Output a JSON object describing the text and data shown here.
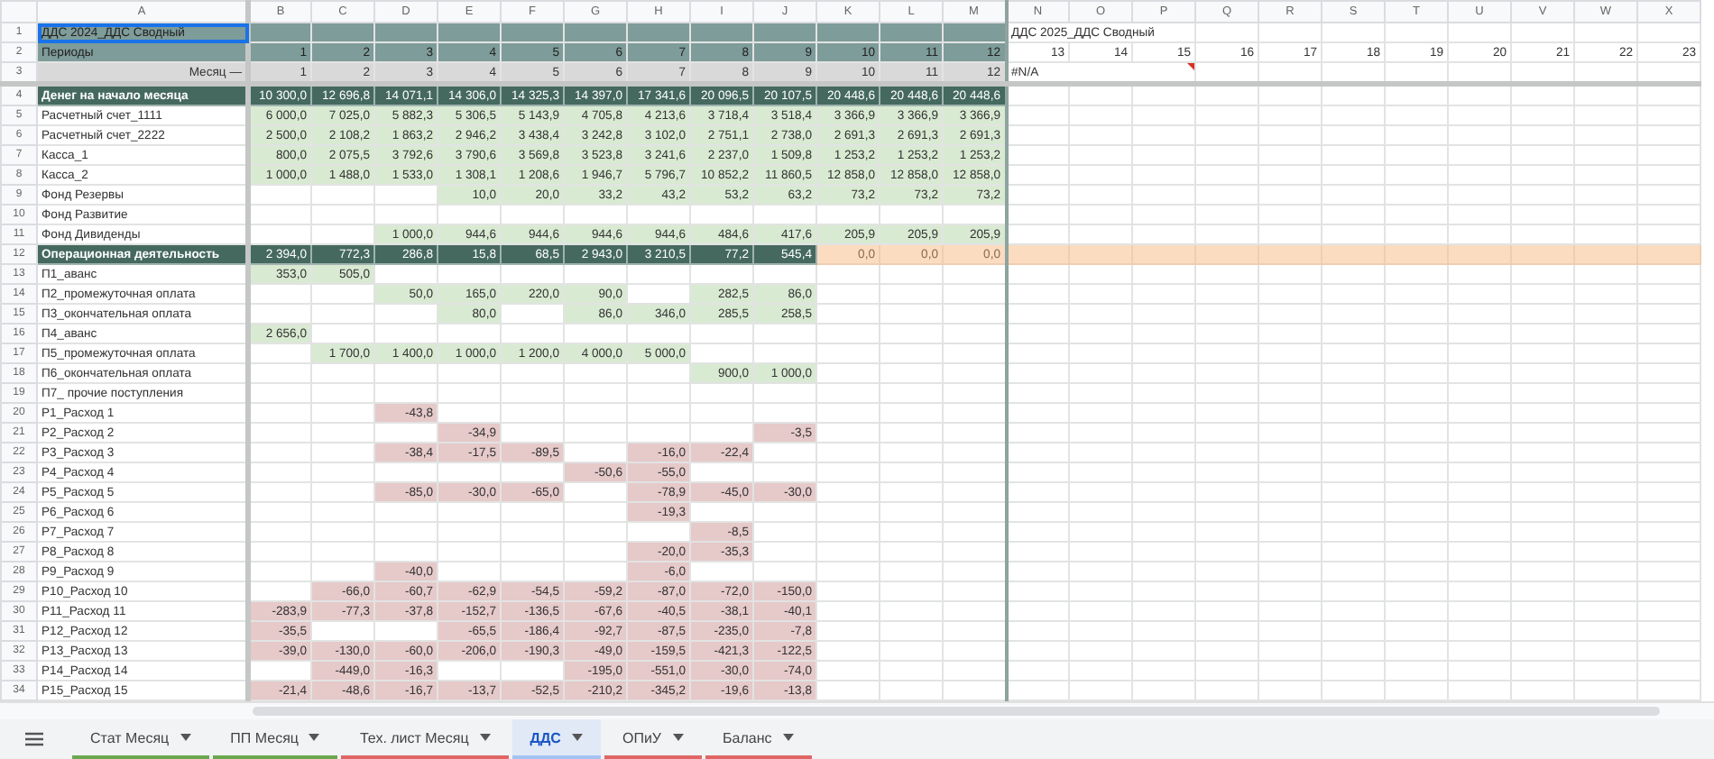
{
  "sheet": {
    "column_headers": [
      "A",
      "B",
      "C",
      "D",
      "E",
      "F",
      "G",
      "H",
      "I",
      "J",
      "K",
      "L",
      "M",
      "N",
      "O",
      "P",
      "Q",
      "R",
      "S",
      "T",
      "U",
      "V",
      "W",
      "X"
    ],
    "rows": [
      {
        "number": "1",
        "kind": "title",
        "label": "ДДС 2024_ДДС Сводный",
        "selected": true,
        "cells": [
          null,
          null,
          null,
          null,
          null,
          null,
          null,
          null,
          null,
          null,
          null,
          null
        ],
        "extras": [
          {
            "text": "ДДС 2025_ДДС Сводный",
            "error": false
          }
        ]
      },
      {
        "number": "2",
        "kind": "period",
        "label": "Периоды",
        "selected": false,
        "cells": [
          "1",
          "2",
          "3",
          "4",
          "5",
          "6",
          "7",
          "8",
          "9",
          "10",
          "11",
          "12"
        ],
        "extras": [
          {
            "text": "13",
            "error": false
          },
          {
            "text": "14",
            "error": false
          },
          {
            "text": "15",
            "error": false
          },
          {
            "text": "16",
            "error": false
          },
          {
            "text": "17",
            "error": false
          },
          {
            "text": "18",
            "error": false
          },
          {
            "text": "19",
            "error": false
          },
          {
            "text": "20",
            "error": false
          },
          {
            "text": "21",
            "error": false
          },
          {
            "text": "22",
            "error": false
          },
          {
            "text": "23",
            "error": false
          }
        ]
      },
      {
        "number": "3",
        "kind": "month",
        "label": "Месяц —",
        "selected": false,
        "cells": [
          "1",
          "2",
          "3",
          "4",
          "5",
          "6",
          "7",
          "8",
          "9",
          "10",
          "11",
          "12"
        ],
        "extras": [
          {
            "text": "#N/A",
            "error": true
          }
        ]
      },
      {
        "number": "4",
        "kind": "balance",
        "label": "Денег на начало месяца",
        "selected": false,
        "cells": [
          "10 300,0",
          "12 696,8",
          "14 071,1",
          "14 306,0",
          "14 325,3",
          "14 397,0",
          "17 341,6",
          "20 096,5",
          "20 107,5",
          "20 448,6",
          "20 448,6",
          "20 448,6"
        ]
      },
      {
        "number": "5",
        "kind": "account",
        "label": "Расчетный счет_1111",
        "selected": false,
        "cells": [
          "6 000,0",
          "7 025,0",
          "5 882,3",
          "5 306,5",
          "5 143,9",
          "4 705,8",
          "4 213,6",
          "3 718,4",
          "3 518,4",
          "3 366,9",
          "3 366,9",
          "3 366,9"
        ]
      },
      {
        "number": "6",
        "kind": "account",
        "label": "Расчетный счет_2222",
        "selected": false,
        "cells": [
          "2 500,0",
          "2 108,2",
          "1 863,2",
          "2 946,2",
          "3 438,4",
          "3 242,8",
          "3 102,0",
          "2 751,1",
          "2 738,0",
          "2 691,3",
          "2 691,3",
          "2 691,3"
        ]
      },
      {
        "number": "7",
        "kind": "account",
        "label": "Касса_1",
        "selected": false,
        "cells": [
          "800,0",
          "2 075,5",
          "3 792,6",
          "3 790,6",
          "3 569,8",
          "3 523,8",
          "3 241,6",
          "2 237,0",
          "1 509,8",
          "1 253,2",
          "1 253,2",
          "1 253,2"
        ]
      },
      {
        "number": "8",
        "kind": "account",
        "label": "Касса_2",
        "selected": false,
        "cells": [
          "1 000,0",
          "1 488,0",
          "1 533,0",
          "1 308,1",
          "1 208,6",
          "1 946,7",
          "5 796,7",
          "10 852,2",
          "11 860,5",
          "12 858,0",
          "12 858,0",
          "12 858,0"
        ]
      },
      {
        "number": "9",
        "kind": "account",
        "label": "Фонд Резервы",
        "selected": false,
        "cells": [
          null,
          null,
          null,
          "10,0",
          "20,0",
          "33,2",
          "43,2",
          "53,2",
          "63,2",
          "73,2",
          "73,2",
          "73,2"
        ]
      },
      {
        "number": "10",
        "kind": "account",
        "label": "Фонд Развитие",
        "selected": false,
        "cells": [
          null,
          null,
          null,
          null,
          null,
          null,
          null,
          null,
          null,
          null,
          null,
          null
        ]
      },
      {
        "number": "11",
        "kind": "account",
        "label": "Фонд Дивиденды",
        "selected": false,
        "cells": [
          null,
          null,
          "1 000,0",
          "944,6",
          "944,6",
          "944,6",
          "944,6",
          "484,6",
          "417,6",
          "205,9",
          "205,9",
          "205,9"
        ]
      },
      {
        "number": "12",
        "kind": "total",
        "label": "Операционная деятельность",
        "selected": false,
        "cells": [
          "2 394,0",
          "772,3",
          "286,8",
          "15,8",
          "68,5",
          "2 943,0",
          "3 210,5",
          "77,2",
          "545,4",
          "0,0",
          "0,0",
          "0,0"
        ],
        "flags": [
          false,
          false,
          false,
          false,
          false,
          false,
          false,
          false,
          false,
          true,
          true,
          true
        ]
      },
      {
        "number": "13",
        "kind": "income",
        "label": "П1_аванс",
        "selected": false,
        "cells": [
          "353,0",
          "505,0",
          null,
          null,
          null,
          null,
          null,
          null,
          null,
          null,
          null,
          null
        ]
      },
      {
        "number": "14",
        "kind": "income",
        "label": "П2_промежуточная оплата",
        "selected": false,
        "cells": [
          null,
          null,
          "50,0",
          "165,0",
          "220,0",
          "90,0",
          null,
          "282,5",
          "86,0",
          null,
          null,
          null
        ]
      },
      {
        "number": "15",
        "kind": "income",
        "label": "П3_окончательная оплата",
        "selected": false,
        "cells": [
          null,
          null,
          null,
          "80,0",
          null,
          "86,0",
          "346,0",
          "285,5",
          "258,5",
          null,
          null,
          null
        ]
      },
      {
        "number": "16",
        "kind": "income",
        "label": "П4_аванс",
        "selected": false,
        "cells": [
          "2 656,0",
          null,
          null,
          null,
          null,
          null,
          null,
          null,
          null,
          null,
          null,
          null
        ]
      },
      {
        "number": "17",
        "kind": "income",
        "label": "П5_промежуточная оплата",
        "selected": false,
        "cells": [
          null,
          "1 700,0",
          "1 400,0",
          "1 000,0",
          "1 200,0",
          "4 000,0",
          "5 000,0",
          null,
          null,
          null,
          null,
          null
        ]
      },
      {
        "number": "18",
        "kind": "income",
        "label": "П6_окончательная оплата",
        "selected": false,
        "cells": [
          null,
          null,
          null,
          null,
          null,
          null,
          null,
          "900,0",
          "1 000,0",
          null,
          null,
          null
        ]
      },
      {
        "number": "19",
        "kind": "income",
        "label": "П7_ прочие поступления",
        "selected": false,
        "cells": [
          null,
          null,
          null,
          null,
          null,
          null,
          null,
          null,
          null,
          null,
          null,
          null
        ]
      },
      {
        "number": "20",
        "kind": "expense",
        "label": "Р1_Расход 1",
        "selected": false,
        "cells": [
          null,
          null,
          "-43,8",
          null,
          null,
          null,
          null,
          null,
          null,
          null,
          null,
          null
        ]
      },
      {
        "number": "21",
        "kind": "expense",
        "label": "Р2_Расход 2",
        "selected": false,
        "cells": [
          null,
          null,
          null,
          "-34,9",
          null,
          null,
          null,
          null,
          "-3,5",
          null,
          null,
          null
        ]
      },
      {
        "number": "22",
        "kind": "expense",
        "label": "Р3_Расход 3",
        "selected": false,
        "cells": [
          null,
          null,
          "-38,4",
          "-17,5",
          "-89,5",
          null,
          "-16,0",
          "-22,4",
          null,
          null,
          null,
          null
        ]
      },
      {
        "number": "23",
        "kind": "expense",
        "label": "Р4_Расход 4",
        "selected": false,
        "cells": [
          null,
          null,
          null,
          null,
          null,
          "-50,6",
          "-55,0",
          null,
          null,
          null,
          null,
          null
        ]
      },
      {
        "number": "24",
        "kind": "expense",
        "label": "Р5_Расход 5",
        "selected": false,
        "cells": [
          null,
          null,
          "-85,0",
          "-30,0",
          "-65,0",
          null,
          "-78,9",
          "-45,0",
          "-30,0",
          null,
          null,
          null
        ]
      },
      {
        "number": "25",
        "kind": "expense",
        "label": "Р6_Расход 6",
        "selected": false,
        "cells": [
          null,
          null,
          null,
          null,
          null,
          null,
          "-19,3",
          null,
          null,
          null,
          null,
          null
        ]
      },
      {
        "number": "26",
        "kind": "expense",
        "label": "Р7_Расход 7",
        "selected": false,
        "cells": [
          null,
          null,
          null,
          null,
          null,
          null,
          null,
          "-8,5",
          null,
          null,
          null,
          null
        ]
      },
      {
        "number": "27",
        "kind": "expense",
        "label": "Р8_Расход 8",
        "selected": false,
        "cells": [
          null,
          null,
          null,
          null,
          null,
          null,
          "-20,0",
          "-35,3",
          null,
          null,
          null,
          null
        ]
      },
      {
        "number": "28",
        "kind": "expense",
        "label": "Р9_Расход 9",
        "selected": false,
        "cells": [
          null,
          null,
          "-40,0",
          null,
          null,
          null,
          "-6,0",
          null,
          null,
          null,
          null,
          null
        ]
      },
      {
        "number": "29",
        "kind": "expense",
        "label": "Р10_Расход 10",
        "selected": false,
        "cells": [
          null,
          "-66,0",
          "-60,7",
          "-62,9",
          "-54,5",
          "-59,2",
          "-87,0",
          "-72,0",
          "-150,0",
          null,
          null,
          null
        ]
      },
      {
        "number": "30",
        "kind": "expense",
        "label": "Р11_Расход 11",
        "selected": false,
        "cells": [
          "-283,9",
          "-77,3",
          "-37,8",
          "-152,7",
          "-136,5",
          "-67,6",
          "-40,5",
          "-38,1",
          "-40,1",
          null,
          null,
          null
        ]
      },
      {
        "number": "31",
        "kind": "expense",
        "label": "Р12_Расход 12",
        "selected": false,
        "cells": [
          "-35,5",
          null,
          null,
          "-65,5",
          "-186,4",
          "-92,7",
          "-87,5",
          "-235,0",
          "-7,8",
          null,
          null,
          null
        ]
      },
      {
        "number": "32",
        "kind": "expense",
        "label": "Р13_Расход 13",
        "selected": false,
        "cells": [
          "-39,0",
          "-130,0",
          "-60,0",
          "-206,0",
          "-190,3",
          "-49,0",
          "-159,5",
          "-421,3",
          "-122,5",
          null,
          null,
          null
        ]
      },
      {
        "number": "33",
        "kind": "expense",
        "label": "Р14_Расход 14",
        "selected": false,
        "cells": [
          null,
          "-449,0",
          "-16,3",
          null,
          null,
          "-195,0",
          "-551,0",
          "-30,0",
          "-74,0",
          null,
          null,
          null
        ]
      },
      {
        "number": "34",
        "kind": "expense",
        "label": "Р15_Расход 15",
        "selected": false,
        "cells": [
          "-21,4",
          "-48,6",
          "-16,7",
          "-13,7",
          "-52,5",
          "-210,2",
          "-345,2",
          "-19,6",
          "-13,8",
          null,
          null,
          null
        ]
      }
    ]
  },
  "sheet_tabs": [
    {
      "label": "Стат Месяц",
      "selected": false,
      "color": "#6aa84f"
    },
    {
      "label": "ПП Месяц",
      "selected": false,
      "color": "#6aa84f"
    },
    {
      "label": "Тех. лист Месяц",
      "selected": false,
      "color": "#e06666"
    },
    {
      "label": "ДДС",
      "selected": true,
      "color": "#a4c2f4"
    },
    {
      "label": "ОПиУ",
      "selected": false,
      "color": "#e06666"
    },
    {
      "label": "Баланс",
      "selected": false,
      "color": "#e06666"
    }
  ]
}
